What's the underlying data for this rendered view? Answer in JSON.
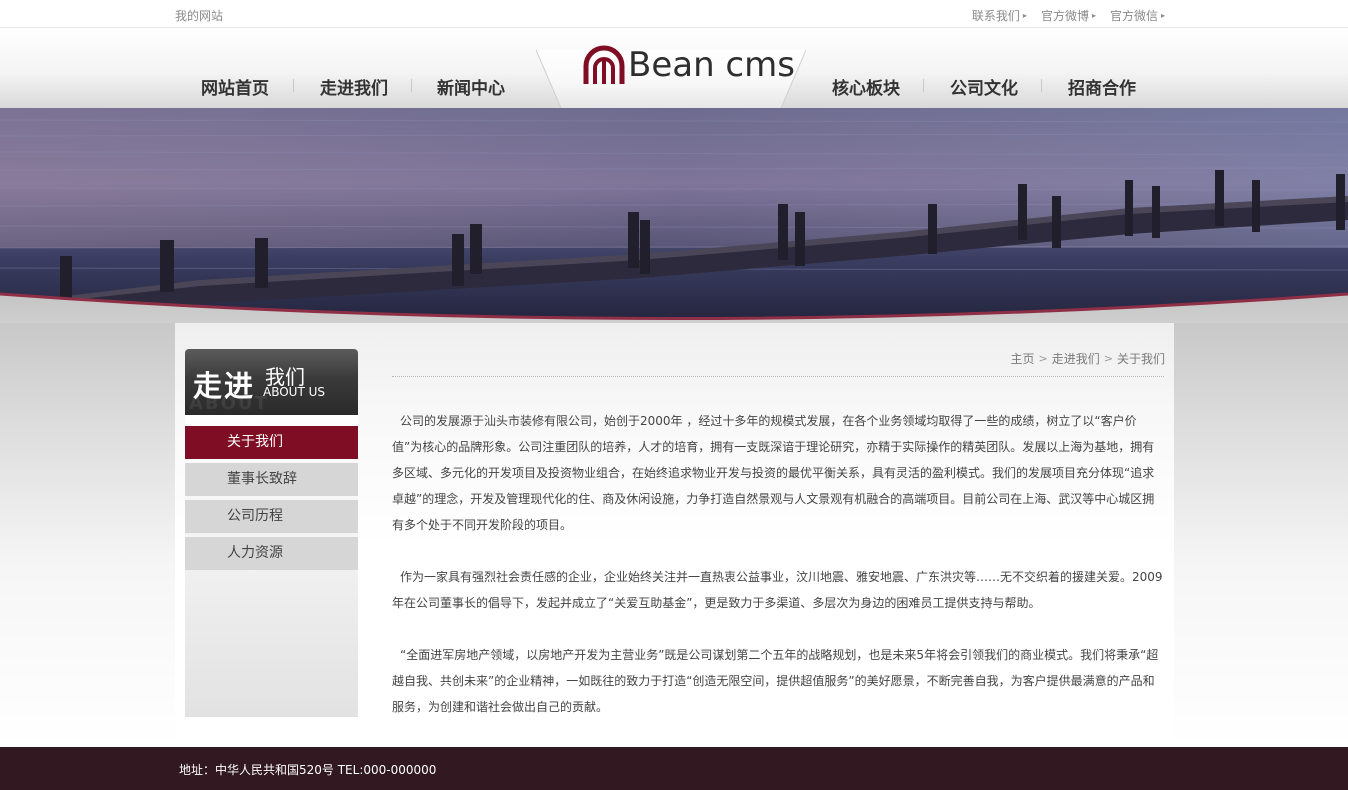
{
  "topbar": {
    "site_name": "我的网站",
    "links": [
      "联系我们",
      "官方微博",
      "官方微信"
    ]
  },
  "header": {
    "logo_text": "Bean cms",
    "nav_left": [
      "网站首页",
      "走进我们",
      "新闻中心"
    ],
    "nav_right": [
      "核心板块",
      "公司文化",
      "招商合作"
    ]
  },
  "sidebar": {
    "title_big": "走进",
    "title_small": "我们",
    "title_en": "ABOUT US",
    "items": [
      {
        "label": "关于我们",
        "active": true
      },
      {
        "label": "董事长致辞",
        "active": false
      },
      {
        "label": "公司历程",
        "active": false
      },
      {
        "label": "人力资源",
        "active": false
      }
    ]
  },
  "breadcrumb": {
    "items": [
      "主页",
      "走进我们",
      "关于我们"
    ],
    "separator": ">"
  },
  "article": {
    "paragraphs": [
      "公司的发展源于汕头市装修有限公司，始创于2000年 ，经过十多年的规模式发展，在各个业务领域均取得了一些的成绩，树立了以“客户价值”为核心的品牌形象。公司注重团队的培养，人才的培育，拥有一支既深谙于理论研究，亦精于实际操作的精英团队。发展以上海为基地，拥有多区域、多元化的开发项目及投资物业组合，在始终追求物业开发与投资的最优平衡关系，具有灵活的盈利模式。我们的发展项目充分体现“追求卓越”的理念，开发及管理现代化的住、商及休闲设施，力争打造自然景观与人文景观有机融合的高端项目。目前公司在上海、武汉等中心城区拥有多个处于不同开发阶段的项目。",
      "作为一家具有强烈社会责任感的企业，企业始终关注并一直热衷公益事业，汶川地震、雅安地震、广东洪灾等……无不交织着的援建关爱。2009年在公司董事长的倡导下，发起并成立了“关爱互助基金”，更是致力于多渠道、多层次为身边的困难员工提供支持与帮助。",
      "“全面进军房地产领域，以房地产开发为主营业务”既是公司谋划第二个五年的战略规划，也是未来5年将会引领我们的商业模式。我们将秉承“超越自我、共创未来”的企业精神，一如既往的致力于打造“创造无限空间，提供超值服务”的美好愿景，不断完善自我，为客户提供最满意的产品和服务，为创建和谐社会做出自己的贡献。"
    ]
  },
  "footer": {
    "text": "地址：中华人民共和国520号 TEL:000-000000"
  },
  "colors": {
    "brand": "#7f0d24",
    "footer_bg": "#321820",
    "sidebar_item_bg": "#d6d6d6"
  }
}
